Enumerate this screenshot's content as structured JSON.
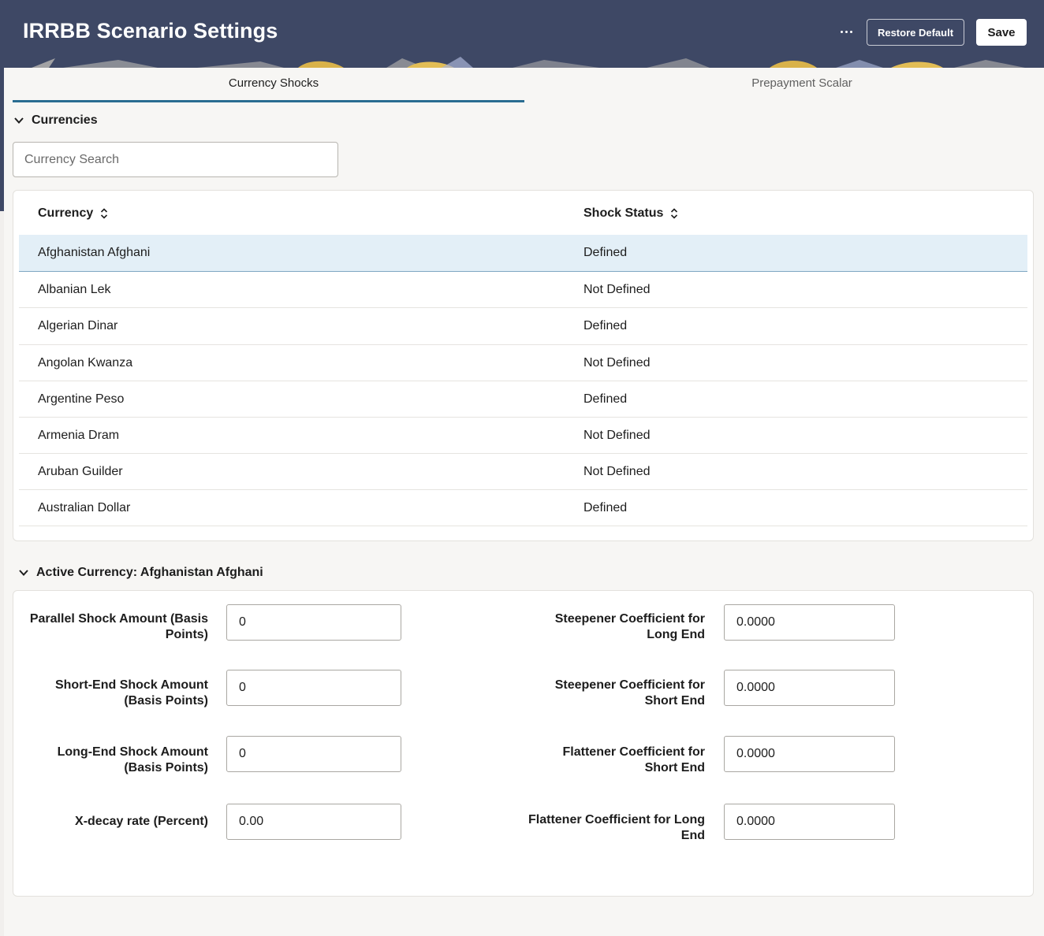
{
  "header": {
    "title": "IRRBB Scenario Settings",
    "restore_label": "Restore Default",
    "save_label": "Save",
    "more_icon": "more-horizontal-icon"
  },
  "tabs": [
    {
      "label": "Currency Shocks",
      "active": true
    },
    {
      "label": "Prepayment Scalar",
      "active": false
    }
  ],
  "currencies": {
    "section_title": "Currencies",
    "search_placeholder": "Currency Search",
    "columns": [
      "Currency",
      "Shock Status"
    ],
    "rows": [
      {
        "currency": "Afghanistan Afghani",
        "status": "Defined"
      },
      {
        "currency": "Albanian Lek",
        "status": "Not Defined"
      },
      {
        "currency": "Algerian Dinar",
        "status": "Defined"
      },
      {
        "currency": "Angolan Kwanza",
        "status": "Not Defined"
      },
      {
        "currency": "Argentine Peso",
        "status": "Defined"
      },
      {
        "currency": "Armenia Dram",
        "status": "Not Defined"
      },
      {
        "currency": "Aruban Guilder",
        "status": "Not Defined"
      },
      {
        "currency": "Australian Dollar",
        "status": "Defined"
      }
    ],
    "selected_row": 0
  },
  "active_currency": {
    "section_title": "Active Currency: Afghanistan Afghani",
    "left_fields": [
      {
        "label_line1": "Parallel Shock Amount (Basis",
        "label_line2": "Points)",
        "value": "0"
      },
      {
        "label_line1": "Short-End Shock Amount",
        "label_line2": "(Basis Points)",
        "value": "0"
      },
      {
        "label_line1": "Long-End Shock Amount",
        "label_line2": "(Basis Points)",
        "value": "0"
      },
      {
        "label_line1": "X-decay rate (Percent)",
        "label_line2": "",
        "value": "0.00"
      }
    ],
    "right_fields": [
      {
        "label_line1": "Steepener Coefficient for",
        "label_line2": "Long End",
        "value": "0.0000"
      },
      {
        "label_line1": "Steepener Coefficient for",
        "label_line2": "Short End",
        "value": "0.0000"
      },
      {
        "label_line1": "Flattener Coefficient for",
        "label_line2": "Short End",
        "value": "0.0000"
      },
      {
        "label_line1": "Flattener Coefficient for Long",
        "label_line2": "End",
        "value": "0.0000"
      }
    ]
  },
  "colors": {
    "header_bg": "#3e4865",
    "tab_indicator": "#2a6c91",
    "selected_row_bg": "#e3eff7",
    "page_bg": "#f7f6f4"
  }
}
